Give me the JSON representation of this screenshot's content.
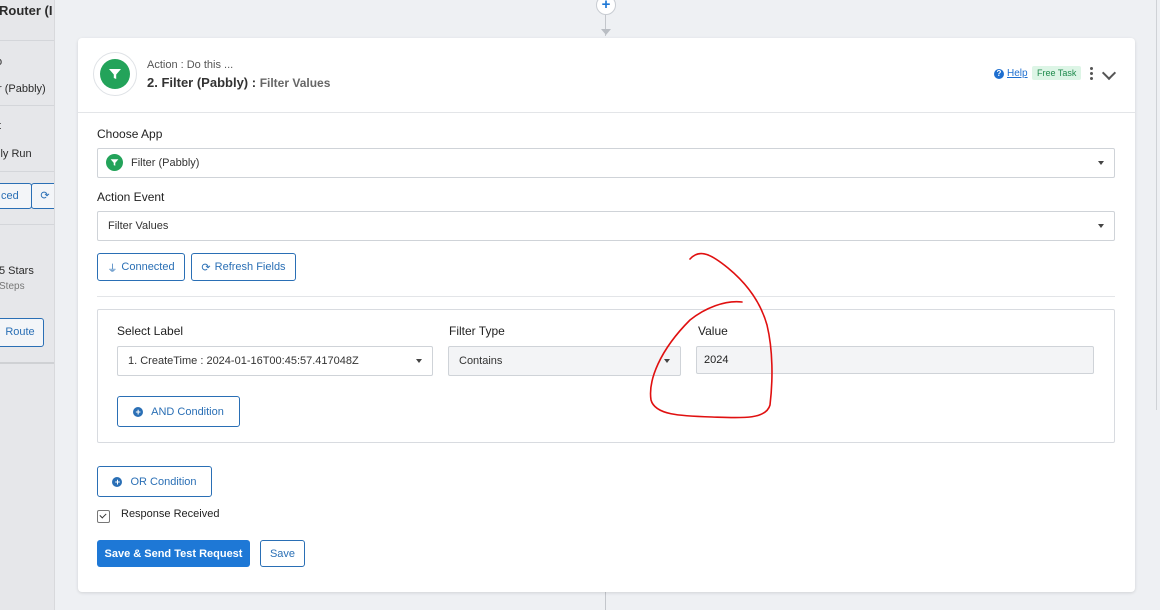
{
  "background_panel": {
    "title": "Router (I",
    "line1": "r (Pabbly)",
    "line2": "lly Run",
    "btn1": "ced",
    "stars": "5 Stars",
    "steps": "Steps",
    "route_btn": "Route",
    "top_mark": "o",
    "mid_mark": "t"
  },
  "step": {
    "caption": "Action : Do this ...",
    "title": "2. Filter (Pabbly) : ",
    "subtitle": "Filter Values",
    "help_label": "Help",
    "badge": "Free Task"
  },
  "form": {
    "choose_app_label": "Choose App",
    "choose_app_value": "Filter (Pabbly)",
    "action_event_label": "Action Event",
    "action_event_value": "Filter Values",
    "connected_label": "Connected",
    "refresh_label": "Refresh Fields"
  },
  "filter": {
    "select_label_header": "Select Label",
    "filter_type_header": "Filter Type",
    "value_header": "Value",
    "select_label_value": "1. CreateTime : 2024-01-16T00:45:57.417048Z",
    "filter_type_value": "Contains",
    "value_value": "2024",
    "and_condition_label": "AND Condition",
    "or_condition_label": "OR Condition"
  },
  "response_received_label": "Response Received",
  "actions": {
    "save_send_label": "Save & Send Test Request",
    "save_label": "Save"
  },
  "colors": {
    "accent": "#1e78d6",
    "logo_green": "#23a35a",
    "annotation_red": "#e01010"
  }
}
